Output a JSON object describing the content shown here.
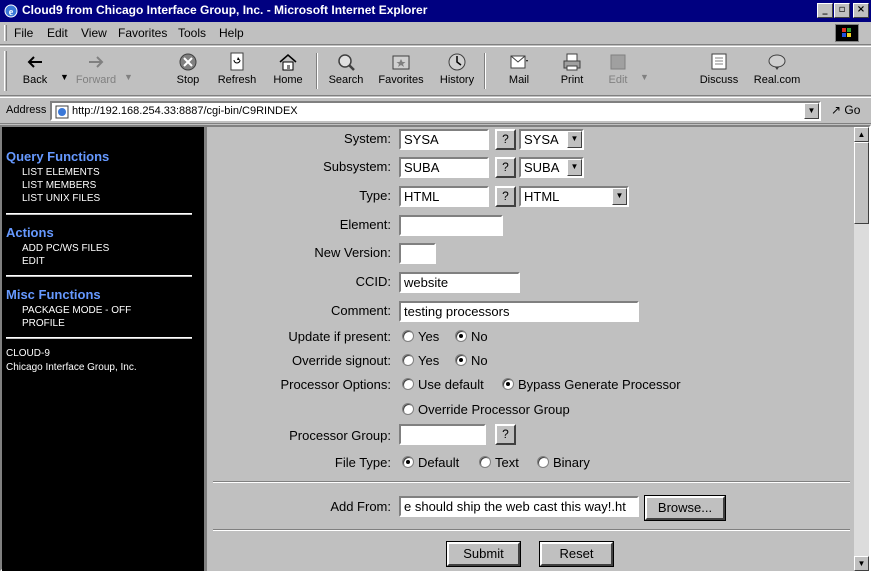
{
  "window": {
    "title": "Cloud9 from Chicago Interface Group, Inc. - Microsoft Internet Explorer",
    "controls": {
      "minimize": "_",
      "maximize": "▫",
      "close": "×"
    }
  },
  "menu": [
    "File",
    "Edit",
    "View",
    "Favorites",
    "Tools",
    "Help"
  ],
  "toolbar": {
    "back": "Back",
    "forward": "Forward",
    "stop": "Stop",
    "refresh": "Refresh",
    "home": "Home",
    "search": "Search",
    "favorites": "Favorites",
    "history": "History",
    "mail": "Mail",
    "print": "Print",
    "edit": "Edit",
    "discuss": "Discuss",
    "realcom": "Real.com"
  },
  "address": {
    "label": "Address",
    "url": "http://192.168.254.33:8887/cgi-bin/C9RINDEX",
    "go": "Go"
  },
  "sidebar": {
    "query_title": "Query Functions",
    "query_items": [
      "LIST ELEMENTS",
      "LIST MEMBERS",
      "LIST UNIX FILES"
    ],
    "actions_title": "Actions",
    "actions_items": [
      "ADD PC/WS FILES",
      "EDIT"
    ],
    "misc_title": "Misc Functions",
    "misc_items": [
      "PACKAGE MODE - OFF",
      "PROFILE"
    ],
    "footer_line1": "CLOUD-9",
    "footer_line2": "Chicago Interface Group, Inc."
  },
  "form": {
    "system": {
      "label": "System:",
      "value": "SYSA",
      "select": "SYSA",
      "help": "?"
    },
    "subsystem": {
      "label": "Subsystem:",
      "value": "SUBA",
      "select": "SUBA",
      "help": "?"
    },
    "type": {
      "label": "Type:",
      "value": "HTML",
      "select": "HTML",
      "help": "?"
    },
    "element": {
      "label": "Element:",
      "value": ""
    },
    "new_version": {
      "label": "New Version:",
      "value": ""
    },
    "ccid": {
      "label": "CCID:",
      "value": "website"
    },
    "comment": {
      "label": "Comment:",
      "value": "testing processors"
    },
    "update_if_present": {
      "label": "Update if present:",
      "yes": "Yes",
      "no": "No",
      "selected": "No"
    },
    "override_signout": {
      "label": "Override signout:",
      "yes": "Yes",
      "no": "No",
      "selected": "No"
    },
    "processor_options": {
      "label": "Processor Options:",
      "use_default": "Use default",
      "bypass": "Bypass Generate Processor",
      "override": "Override Processor Group",
      "selected": "Bypass Generate Processor"
    },
    "processor_group": {
      "label": "Processor Group:",
      "value": "",
      "help": "?"
    },
    "file_type": {
      "label": "File Type:",
      "default": "Default",
      "text": "Text",
      "binary": "Binary",
      "selected": "Default"
    },
    "add_from": {
      "label": "Add From:",
      "value": "e should ship the web cast this way!.ht",
      "browse": "Browse..."
    },
    "submit": "Submit",
    "reset": "Reset"
  },
  "scrollbar": {
    "up": "▲",
    "down": "▼"
  }
}
